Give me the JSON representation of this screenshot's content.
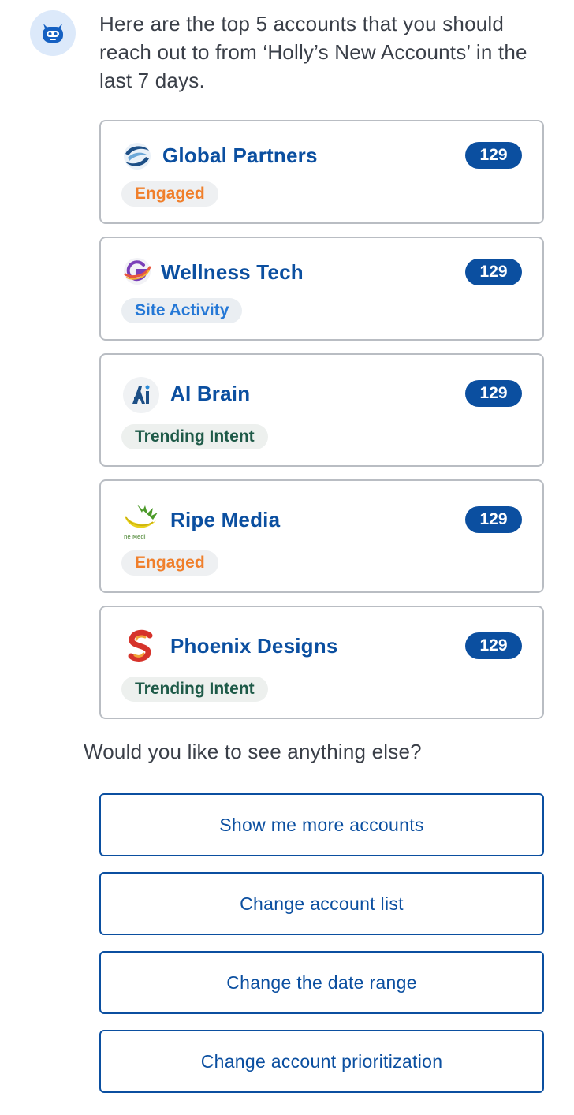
{
  "assistant": {
    "avatar_icon": "robot-icon",
    "message": "Here are the top 5 accounts that you should reach out to from ‘Holly’s New Accounts’ in the last 7 days."
  },
  "accounts": [
    {
      "name": "Global Partners",
      "score": "129",
      "tag": "Engaged",
      "logo_icon": "swirl-globe-logo"
    },
    {
      "name": "Wellness Tech",
      "score": "129",
      "tag": "Site Activity",
      "logo_icon": "orbit-g-logo"
    },
    {
      "name": "AI Brain",
      "score": "129",
      "tag": "Trending Intent",
      "logo_icon": "ai-circle-logo"
    },
    {
      "name": "Ripe Media",
      "score": "129",
      "tag": "Engaged",
      "logo_icon": "banana-leaf-logo",
      "logo_text": "ne Medi"
    },
    {
      "name": "Phoenix Designs",
      "score": "129",
      "tag": "Trending Intent",
      "logo_icon": "red-s-logo"
    }
  ],
  "followup": {
    "question": "Would you like to see anything else?",
    "options": [
      "Show me more accounts",
      "Change account list",
      "Change the date range",
      "Change account prioritization"
    ]
  },
  "colors": {
    "brand_blue": "#0b4fa0",
    "engaged_orange": "#f07f2b",
    "site_activity_blue": "#2578d6",
    "trending_green": "#1e5a48"
  }
}
